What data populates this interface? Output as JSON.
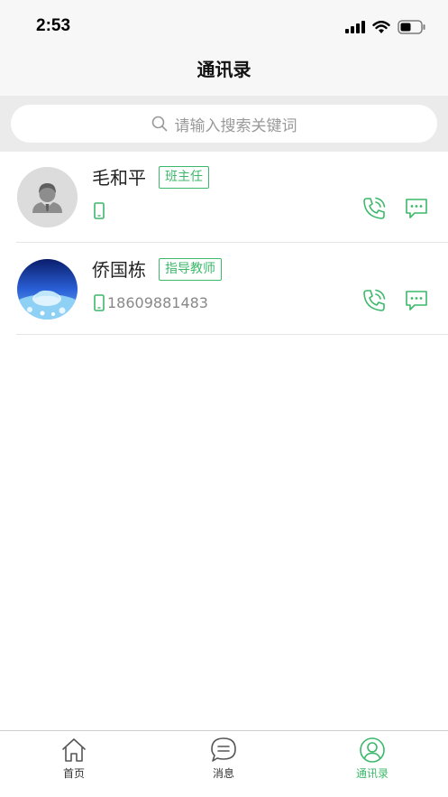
{
  "status_bar": {
    "time": "2:53"
  },
  "nav": {
    "title": "通讯录"
  },
  "search": {
    "placeholder": "请输入搜索关键词"
  },
  "contacts": [
    {
      "name": "毛和平",
      "role": "班主任",
      "phone": ""
    },
    {
      "name": "侨国栋",
      "role": "指导教师",
      "phone": "18609881483"
    }
  ],
  "tabs": [
    {
      "label": "首页",
      "icon": "home-icon",
      "active": false
    },
    {
      "label": "消息",
      "icon": "message-icon",
      "active": false
    },
    {
      "label": "通讯录",
      "icon": "contacts-icon",
      "active": true
    }
  ],
  "colors": {
    "accent": "#3cb86a",
    "header_bg": "#f7f7f7",
    "search_bg": "#ebebeb"
  }
}
